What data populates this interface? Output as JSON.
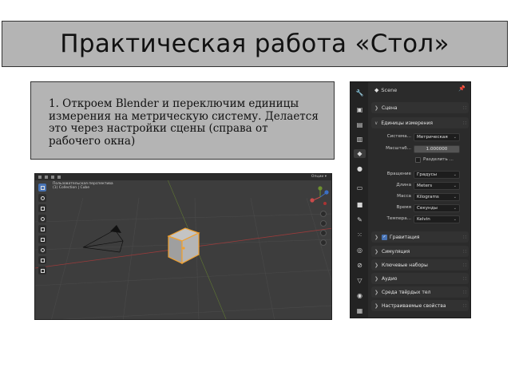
{
  "slide": {
    "title": "Практическая работа «Стол»",
    "instruction": "1. Откроем Blender и переключим единицы измерения на метрическую систему. Делается это через настройки сцены (справа от рабочего окна)"
  },
  "viewport": {
    "info_line1": "Пользовательская перспектива",
    "info_line2": "(1) Collection | Cube",
    "right_label": "Опции ▾",
    "colors": {
      "bg": "#3d3d3d",
      "grid": "#4a4a4a",
      "x_axis": "#9b3b3b",
      "y_axis": "#6d8f2f",
      "cube": "#b3b3b3",
      "selected_outline": "#f0a030"
    }
  },
  "properties": {
    "header": {
      "icon": "scene-icon",
      "label": "Scene"
    },
    "sections": {
      "scene": "Сцена",
      "units": "Единицы измерения",
      "gravity": "Гравитация",
      "simulation": "Симуляция",
      "keying_sets": "Ключевые наборы",
      "audio": "Аудио",
      "rigid_body": "Среда твёрдых тел",
      "custom_props": "Настраиваемые свойства"
    },
    "unit_rows": {
      "system": {
        "label": "Система...",
        "value": "Метрическая"
      },
      "scale": {
        "label": "Масштаб...",
        "value": "1.000000"
      },
      "separate": {
        "label": "Разделить ...",
        "checked": false
      },
      "rotation": {
        "label": "Вращение",
        "value": "Градусы"
      },
      "length": {
        "label": "Длина",
        "value": "Meters"
      },
      "mass": {
        "label": "Масса",
        "value": "Kilograms"
      },
      "time": {
        "label": "Время",
        "value": "Секунды"
      },
      "temperature": {
        "label": "Темпера...",
        "value": "Kelvin"
      }
    },
    "gravity_checked": true,
    "accent": "#4772b3"
  }
}
